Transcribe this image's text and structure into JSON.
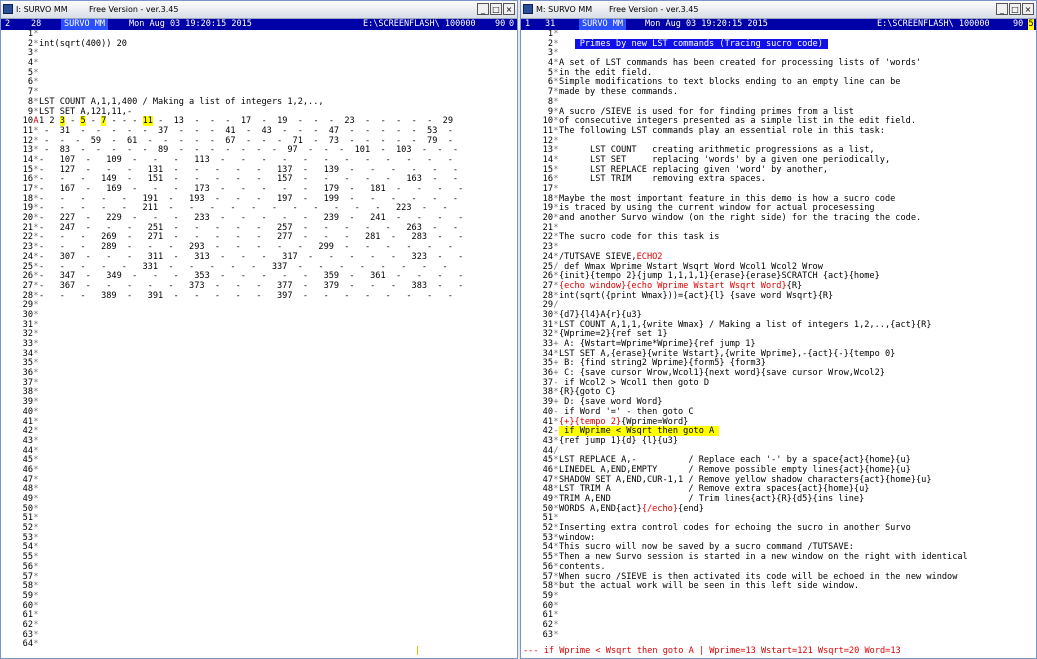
{
  "left": {
    "title": "I: SURVO MM",
    "version": "Free Version  -  ver.3.45",
    "status": {
      "col1": "2",
      "col2": "28",
      "prog": "SURVO MM",
      "date": "Mon Aug 03 19:20:15 2015",
      "path": "E:\\SCREENFLASH\\ 100000",
      "num": "90",
      "flag": "0"
    },
    "lines": [
      {
        "n": "1",
        "c": "*",
        "t": ""
      },
      {
        "n": "2",
        "c": "*",
        "t": "int(sqrt(400)) 20"
      },
      {
        "n": "3",
        "c": "*",
        "t": ""
      },
      {
        "n": "4",
        "c": "*",
        "t": ""
      },
      {
        "n": "5",
        "c": "*",
        "t": ""
      },
      {
        "n": "6",
        "c": "*",
        "t": ""
      },
      {
        "n": "7",
        "c": "*",
        "t": ""
      },
      {
        "n": "8",
        "c": "*",
        "t": "LST COUNT A,1,1,400 / Making a list of integers 1,2,..,"
      },
      {
        "n": "9",
        "c": "*",
        "t": "LST SET A,121,11,-"
      },
      {
        "n": "10",
        "c": "A",
        "t": "1",
        "h1": " 2 ",
        "m1": "3",
        "h2": " - ",
        "m2": "5",
        "h3": " - ",
        "m3": "7",
        "h4": " - - - ",
        "m4": "11",
        "h5": " - ",
        "rest": " 13  -  -  -  17  -  19  -  -  -  23  -  -  -  -  -  29"
      },
      {
        "n": "11",
        "c": "*",
        "t": " -  31  -  -  -  -  -  37  -  -  -  41  -  43  -  -  -  47  -  -  -  -  -  53  -"
      },
      {
        "n": "12",
        "c": "*",
        "t": " -  -  -  59  -  61  -  -  -  -  -  67  -  -  -  71  -  73  -  -  -  -  -  79  -"
      },
      {
        "n": "13",
        "c": "*",
        "t": " -  83  -  -  -  -  -  89  -  -  -  -  -  -  -  97  -  -  -  101  -  103  -  -  -"
      },
      {
        "n": "14",
        "c": "*",
        "t": "-   107  -   109  -   -   -   113  -   -   -   -   -   -   -   -   -   -   -   -"
      },
      {
        "n": "15",
        "c": "*",
        "t": "-   127  -   -   -   131  -   -   -   -   -   137  -   139  -   -   -   -   -   -"
      },
      {
        "n": "16",
        "c": "*",
        "t": "-   -   -   149  -   151  -   -   -   -   -   157  -   -   -   -   -   163  -   -"
      },
      {
        "n": "17",
        "c": "*",
        "t": "-   167  -   169  -   -   -   173  -   -   -   -   -   179  -   181  -   -   -   -"
      },
      {
        "n": "18",
        "c": "*",
        "t": "-   -   -   -   -   191  -   193  -   -   -   197  -   199  -   -   -   -   -   -"
      },
      {
        "n": "19",
        "c": "*",
        "t": "-   -   -   -   -   211  -   -   -   -   -   -   -   -   -   -   -   223  -   -"
      },
      {
        "n": "20",
        "c": "*",
        "t": "-   227  -   229  -   -   -   233  -   -   -   -   -   239  -   241  -   -   -   -"
      },
      {
        "n": "21",
        "c": "*",
        "t": "-   247  -   -   -   251  -   -   -   -   -   257  -   -   -   -   -   263  -   -"
      },
      {
        "n": "22",
        "c": "*",
        "t": "-   -   -   269  -   271  -   -   -   -   -   277  -   -   -   281  -   283  -   -"
      },
      {
        "n": "23",
        "c": "*",
        "t": "-   -   -   289  -   -   -   293  -   -   -   -   -   299  -   -   -   -   -   -"
      },
      {
        "n": "24",
        "c": "*",
        "t": "-   307  -   -   -   311  -   313  -   -   -   317  -   -   -   -   -   323  -   -"
      },
      {
        "n": "25",
        "c": "*",
        "t": "-   -   -   -   -   331  -   -   -   -   -   337  -   -   -   -   -   -   -   -"
      },
      {
        "n": "26",
        "c": "*",
        "t": "-   347  -   349  -   -   -   353  -   -   -   -   -   359  -   361  -   -   -   -"
      },
      {
        "n": "27",
        "c": "*",
        "t": "-   367  -   -   -   -   -   373  -   -   -   377  -   379  -   -   -   383  -   -"
      },
      {
        "n": "28",
        "c": "*",
        "t": "-   -   -   389  -   391  -   -   -   -   -   397  -   -   -   -   -   -   -   -"
      },
      {
        "n": "29",
        "c": "*",
        "t": ""
      },
      {
        "n": "30",
        "c": "*",
        "t": ""
      },
      {
        "n": "31",
        "c": "*",
        "t": ""
      },
      {
        "n": "32",
        "c": "*",
        "t": ""
      },
      {
        "n": "33",
        "c": "*",
        "t": ""
      },
      {
        "n": "34",
        "c": "*",
        "t": ""
      },
      {
        "n": "35",
        "c": "*",
        "t": ""
      },
      {
        "n": "36",
        "c": "*",
        "t": ""
      },
      {
        "n": "37",
        "c": "*",
        "t": ""
      },
      {
        "n": "38",
        "c": "*",
        "t": ""
      },
      {
        "n": "39",
        "c": "*",
        "t": ""
      },
      {
        "n": "40",
        "c": "*",
        "t": ""
      },
      {
        "n": "41",
        "c": "*",
        "t": ""
      },
      {
        "n": "42",
        "c": "*",
        "t": ""
      },
      {
        "n": "43",
        "c": "*",
        "t": ""
      },
      {
        "n": "44",
        "c": "*",
        "t": ""
      },
      {
        "n": "45",
        "c": "*",
        "t": ""
      },
      {
        "n": "46",
        "c": "*",
        "t": ""
      },
      {
        "n": "47",
        "c": "*",
        "t": ""
      },
      {
        "n": "48",
        "c": "*",
        "t": ""
      },
      {
        "n": "49",
        "c": "*",
        "t": ""
      },
      {
        "n": "50",
        "c": "*",
        "t": ""
      },
      {
        "n": "51",
        "c": "*",
        "t": ""
      },
      {
        "n": "52",
        "c": "*",
        "t": ""
      },
      {
        "n": "53",
        "c": "*",
        "t": ""
      },
      {
        "n": "54",
        "c": "*",
        "t": ""
      },
      {
        "n": "55",
        "c": "*",
        "t": ""
      },
      {
        "n": "56",
        "c": "*",
        "t": ""
      },
      {
        "n": "57",
        "c": "*",
        "t": ""
      },
      {
        "n": "58",
        "c": "*",
        "t": ""
      },
      {
        "n": "59",
        "c": "*",
        "t": ""
      },
      {
        "n": "60",
        "c": "*",
        "t": ""
      },
      {
        "n": "61",
        "c": "*",
        "t": ""
      },
      {
        "n": "62",
        "c": "*",
        "t": ""
      },
      {
        "n": "63",
        "c": "*",
        "t": ""
      },
      {
        "n": "64",
        "c": "*",
        "t": ""
      }
    ]
  },
  "right": {
    "title": "M: SURVO MM",
    "version": "Free Version  -  ver.3.45",
    "status": {
      "col1": "1",
      "col2": "31",
      "prog": "SURVO MM",
      "date": "Mon Aug 03 19:20:15 2015",
      "path": "E:\\SCREENFLASH\\ 100000",
      "num": "90",
      "flag": "5"
    },
    "lines": [
      {
        "n": "1",
        "c": "*",
        "t": ""
      },
      {
        "n": "2",
        "c": "*",
        "t": "   ",
        "b": " Primes by new LST commands (Tracing sucro code) "
      },
      {
        "n": "3",
        "c": "*",
        "t": ""
      },
      {
        "n": "4",
        "c": "*",
        "t": "A set of LST commands has been created for processing lists of 'words'"
      },
      {
        "n": "5",
        "c": "*",
        "t": "in the edit field."
      },
      {
        "n": "6",
        "c": "*",
        "t": "Simple modifications to text blocks ending to an empty line can be"
      },
      {
        "n": "7",
        "c": "*",
        "t": "made by these commands."
      },
      {
        "n": "8",
        "c": "*",
        "t": ""
      },
      {
        "n": "9",
        "c": "*",
        "t": "A sucro /SIEVE is used for for finding primes from a list"
      },
      {
        "n": "10",
        "c": "*",
        "t": "of consecutive integers presented as a simple list in the edit field."
      },
      {
        "n": "11",
        "c": "*",
        "t": "The following LST commands play an essential role in this task:"
      },
      {
        "n": "12",
        "c": "*",
        "t": ""
      },
      {
        "n": "13",
        "c": "*",
        "t": "      LST COUNT   creating arithmetic progressions as a list,"
      },
      {
        "n": "14",
        "c": "*",
        "t": "      LST SET     replacing 'words' by a given one periodically,"
      },
      {
        "n": "15",
        "c": "*",
        "t": "      LST REPLACE replacing given 'word' by another,"
      },
      {
        "n": "16",
        "c": "*",
        "t": "      LST TRIM    removing extra spaces."
      },
      {
        "n": "17",
        "c": "*",
        "t": ""
      },
      {
        "n": "18",
        "c": "*",
        "t": "Maybe the most important feature in this demo is how a sucro code"
      },
      {
        "n": "19",
        "c": "*",
        "t": "is traced by using the current window for actual procesessing"
      },
      {
        "n": "20",
        "c": "*",
        "t": "and another Survo window (on the right side) for the tracing the code."
      },
      {
        "n": "21",
        "c": "*",
        "t": ""
      },
      {
        "n": "22",
        "c": "*",
        "t": "The sucro code for this task is"
      },
      {
        "n": "23",
        "c": "*",
        "t": ""
      },
      {
        "n": "24",
        "c": "*",
        "t": "/TUTSAVE SIEVE,",
        "r": "ECHO2"
      },
      {
        "n": "25",
        "c": "/",
        "t": " def Wmax Wprime Wstart Wsqrt Word Wcol1 Wcol2 Wrow"
      },
      {
        "n": "26",
        "c": "*",
        "t": "{init}{tempo 2}{jump 1,1,1,1}{erase}{erase}SCRATCH {act}{home}"
      },
      {
        "n": "27",
        "c": "*",
        "t": "",
        "r": "{echo window}{echo Wprime Wstart Wsqrt Word}",
        "t2": "{R}"
      },
      {
        "n": "28",
        "c": "*",
        "t": "int(sqrt({print Wmax}))={act}{l} {save word Wsqrt}{R}"
      },
      {
        "n": "29",
        "c": "/",
        "t": ""
      },
      {
        "n": "30",
        "c": "*",
        "t": "{d7}{l4}A{r}{u3}"
      },
      {
        "n": "31",
        "c": "*",
        "t": "LST COUNT A,1,1,{write Wmax} / Making a list of integers 1,2,..,{act}{R}"
      },
      {
        "n": "32",
        "c": "*",
        "t": "{Wprime=2}{ref set 1}"
      },
      {
        "n": "33",
        "c": "+",
        "t": " A: {Wstart=Wprime*Wprime}{ref jump 1}"
      },
      {
        "n": "34",
        "c": "*",
        "t": "LST SET A,{erase}{write Wstart},{write Wprime},-{act}{-}{tempo 0}"
      },
      {
        "n": "35",
        "c": "+",
        "t": " B: {find string2 Wprime}{form5} {form3}"
      },
      {
        "n": "36",
        "c": "+",
        "t": " C: {save cursor Wrow,Wcol1}{next word}{save cursor Wrow,Wcol2}"
      },
      {
        "n": "37",
        "c": "-",
        "t": " if Wcol2 > Wcol1 then goto D"
      },
      {
        "n": "38",
        "c": "*",
        "t": "{R}{goto C}"
      },
      {
        "n": "39",
        "c": "+",
        "t": " D: {save word Word}"
      },
      {
        "n": "40",
        "c": "-",
        "t": " if Word '=' - then goto C"
      },
      {
        "n": "41",
        "c": "*",
        "t": "",
        "r": "{+}{tempo 2}",
        "t2": "{Wprime=Word}"
      },
      {
        "n": "42",
        "c": "-",
        "t": "",
        "y": " if Wprime < Wsqrt then goto A "
      },
      {
        "n": "43",
        "c": "*",
        "t": "{ref jump 1}{d} {l}{u3}"
      },
      {
        "n": "44",
        "c": "/",
        "t": ""
      },
      {
        "n": "45",
        "c": "*",
        "t": "LST REPLACE A,-          / Replace each '-' by a space{act}{home}{u}"
      },
      {
        "n": "46",
        "c": "*",
        "t": "LINEDEL A,END,EMPTY      / Remove possible empty lines{act}{home}{u}"
      },
      {
        "n": "47",
        "c": "*",
        "t": "SHADOW SET A,END,CUR-1,1 / Remove yellow shadow characters{act}{home}{u}"
      },
      {
        "n": "48",
        "c": "*",
        "t": "LST TRIM A               / Remove extra spaces{act}{home}{u}"
      },
      {
        "n": "49",
        "c": "*",
        "t": "TRIM A,END               / Trim lines{act}{R}{d5}{ins line}"
      },
      {
        "n": "50",
        "c": "*",
        "t": "WORDS A,END{act}",
        "r": "{/echo}",
        "t2": "{end}"
      },
      {
        "n": "51",
        "c": "*",
        "t": ""
      },
      {
        "n": "52",
        "c": "*",
        "t": "Inserting extra control codes for echoing the sucro in another Survo"
      },
      {
        "n": "53",
        "c": "*",
        "t": "window:"
      },
      {
        "n": "54",
        "c": "*",
        "t": "This sucro will now be saved by a sucro command /TUTSAVE:"
      },
      {
        "n": "55",
        "c": "*",
        "t": "Then a new Survo session is started in a new window on the right with identical"
      },
      {
        "n": "56",
        "c": "*",
        "t": "contents."
      },
      {
        "n": "57",
        "c": "*",
        "t": "When sucro /SIEVE is then activated its code will be echoed in the new window"
      },
      {
        "n": "58",
        "c": "*",
        "t": "but the actual work will be seen in this left side window."
      },
      {
        "n": "59",
        "c": "*",
        "t": ""
      },
      {
        "n": "60",
        "c": "*",
        "t": ""
      },
      {
        "n": "61",
        "c": "*",
        "t": ""
      },
      {
        "n": "62",
        "c": "*",
        "t": ""
      },
      {
        "n": "63",
        "c": "*",
        "t": ""
      }
    ],
    "trace": "--- if Wprime < Wsqrt then goto A | Wprime=13 Wstart=121 Wsqrt=20 Word=13"
  },
  "icons": {
    "minimize": "_",
    "maximize": "□",
    "close": "×"
  },
  "colors": {
    "status_bg": "#0000a8",
    "highlight": "#ffff00",
    "title_bar_blue": "#1010e8",
    "echo_red": "#dd0000"
  }
}
